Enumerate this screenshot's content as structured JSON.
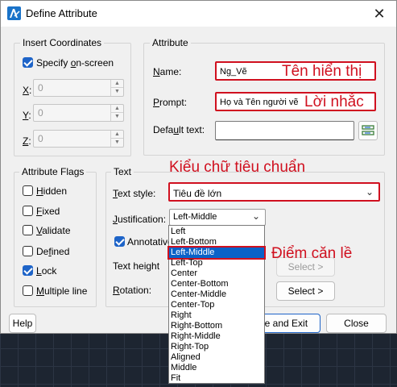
{
  "window": {
    "title": "Define Attribute",
    "close_glyph": "✕"
  },
  "insert_coordinates": {
    "legend": "Insert Coordinates",
    "specify_onscreen": {
      "pre": "Specify ",
      "ul": "o",
      "post": "n-screen",
      "checked": true
    },
    "x": {
      "ul": "X",
      "post": ":",
      "value": "0"
    },
    "y": {
      "ul": "Y",
      "post": ":",
      "value": "0"
    },
    "z": {
      "ul": "Z",
      "post": ":",
      "value": "0"
    }
  },
  "attribute": {
    "legend": "Attribute",
    "name_label": {
      "pre": "",
      "ul": "N",
      "post": "ame:"
    },
    "name_value": "Ng_Vẽ",
    "prompt_label": {
      "pre": "",
      "ul": "P",
      "post": "rompt:"
    },
    "prompt_value": "Họ và Tên người vẽ",
    "default_label": {
      "pre": "Defa",
      "ul": "u",
      "post": "lt text:"
    },
    "default_value": ""
  },
  "attribute_flags": {
    "legend": "Attribute Flags",
    "items": [
      {
        "pre": "",
        "ul": "H",
        "post": "idden",
        "checked": false
      },
      {
        "pre": "",
        "ul": "F",
        "post": "ixed",
        "checked": false
      },
      {
        "pre": "",
        "ul": "V",
        "post": "alidate",
        "checked": false
      },
      {
        "pre": "De",
        "ul": "f",
        "post": "ined",
        "checked": false
      },
      {
        "pre": "",
        "ul": "L",
        "post": "ock",
        "checked": true
      },
      {
        "pre": "",
        "ul": "M",
        "post": "ultiple line",
        "checked": false
      }
    ]
  },
  "text": {
    "legend": "Text",
    "style_label": {
      "pre": "",
      "ul": "T",
      "post": "ext style:"
    },
    "style_value": "Tiêu đề lớn",
    "justification_label": {
      "pre": "",
      "ul": "J",
      "post": "ustification:"
    },
    "justification_value": "Left-Middle",
    "annotative_label": {
      "pre": "Annotative",
      "ul": "",
      "post": ""
    },
    "annotative_checked": true,
    "height_label": {
      "pre": "Text height",
      "ul": "",
      "post": ""
    },
    "rotation_label": {
      "pre": "",
      "ul": "R",
      "post": "otation:"
    },
    "select_height": "Select >",
    "select_rotation": "Select >"
  },
  "justification_options": [
    "Left",
    "Left-Bottom",
    "Left-Middle",
    "Left-Top",
    "Center",
    "Center-Bottom",
    "Center-Middle",
    "Center-Top",
    "Right",
    "Right-Bottom",
    "Right-Middle",
    "Right-Top",
    "Aligned",
    "Middle",
    "Fit"
  ],
  "justification_selected_index": 2,
  "buttons": {
    "help": "Help",
    "define_exit": "fine and Exit",
    "close": "Close"
  },
  "annotations": {
    "name": "Tên hiển thị",
    "prompt": "Lời nhắc",
    "text_style": "Kiểu chữ tiêu chuẩn",
    "justification": "Điểm căn lề"
  },
  "colors": {
    "accent": "#1e64c8",
    "annotation_red": "#d0101f",
    "selection": "#0a62c8"
  }
}
